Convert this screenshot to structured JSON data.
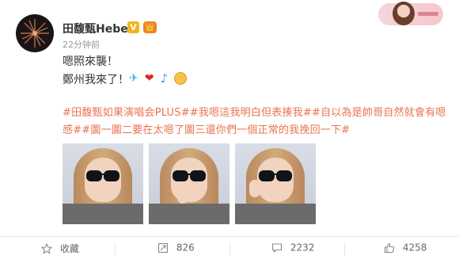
{
  "post": {
    "author": "田馥甄Hebe",
    "verified_badge": "V",
    "member_badge": "👑",
    "time": "22分钟前",
    "line1": "嗯照來襲！",
    "line2": "鄭州我來了！",
    "emojis": [
      "plane-icon",
      "heart-icon",
      "music-note-icon",
      "smile-icon"
    ],
    "hashtags_line1": "#田馥甄如果演唱会PLUS##我嗯這我明白但表揍我##自以為是帥哥自然就會有嗯",
    "hashtags_line2": "感##圖一圖二要在太嗯了圖三還你們一個正常的我挽回一下#"
  },
  "actions": {
    "save": "收藏",
    "repost_count": "826",
    "comment_count": "2232",
    "like_count": "4258"
  },
  "colors": {
    "hashtag": "#eb7350",
    "verified": "#f5b419",
    "badge": "#f4801f",
    "muted": "#999999"
  }
}
